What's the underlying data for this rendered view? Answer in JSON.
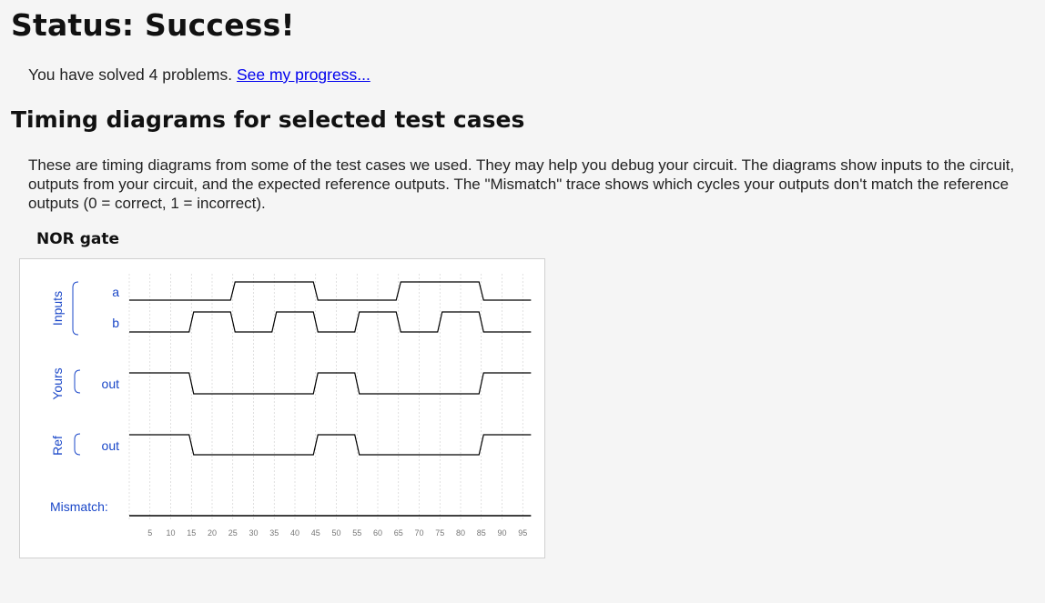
{
  "status": {
    "title": "Status: Success!"
  },
  "progress": {
    "text": "You have solved 4 problems. ",
    "link": "See my progress..."
  },
  "section": {
    "title": "Timing diagrams for selected test cases",
    "description": "These are timing diagrams from some of the test cases we used. They may help you debug your circuit. The diagrams show inputs to the circuit, outputs from your circuit, and the expected reference outputs. The \"Mismatch\" trace shows which cycles your outputs don't match the reference outputs (0 = correct, 1 = incorrect)."
  },
  "diagram": {
    "title": "NOR gate",
    "groups": {
      "inputs": "Inputs",
      "yours": "Yours",
      "ref": "Ref"
    },
    "mismatch_label": "Mismatch:",
    "colors": {
      "label": "#1a47c8",
      "trace": "#000000",
      "grid": "#cccccc"
    }
  },
  "chart_data": {
    "type": "timing",
    "time_ticks": [
      5,
      10,
      15,
      20,
      25,
      30,
      35,
      40,
      45,
      50,
      55,
      60,
      65,
      70,
      75,
      80,
      85,
      90,
      95
    ],
    "time_range": [
      0,
      97
    ],
    "signals": [
      {
        "group": "Inputs",
        "name": "a",
        "initial": 0,
        "transitions": [
          [
            25,
            1
          ],
          [
            45,
            0
          ],
          [
            65,
            1
          ],
          [
            85,
            0
          ]
        ]
      },
      {
        "group": "Inputs",
        "name": "b",
        "initial": 0,
        "transitions": [
          [
            15,
            1
          ],
          [
            25,
            0
          ],
          [
            35,
            1
          ],
          [
            45,
            0
          ],
          [
            55,
            1
          ],
          [
            65,
            0
          ],
          [
            75,
            1
          ],
          [
            85,
            0
          ]
        ]
      },
      {
        "group": "Yours",
        "name": "out",
        "initial": 1,
        "transitions": [
          [
            15,
            0
          ],
          [
            45,
            1
          ],
          [
            55,
            0
          ],
          [
            85,
            1
          ]
        ]
      },
      {
        "group": "Ref",
        "name": "out",
        "initial": 1,
        "transitions": [
          [
            15,
            0
          ],
          [
            45,
            1
          ],
          [
            55,
            0
          ],
          [
            85,
            1
          ]
        ]
      },
      {
        "group": "Mismatch",
        "name": "Mismatch:",
        "initial": 0,
        "transitions": []
      }
    ]
  }
}
